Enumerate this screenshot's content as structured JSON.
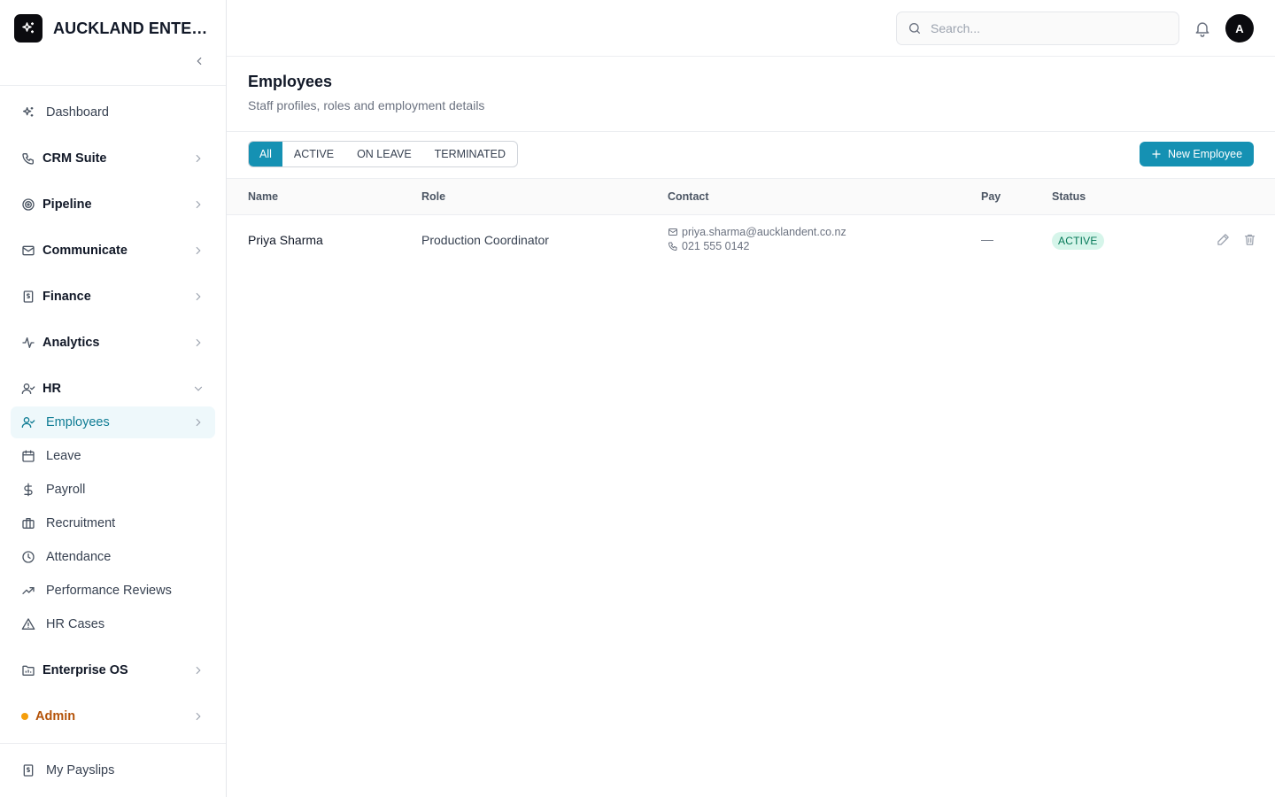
{
  "brand": {
    "name": "AUCKLAND ENTERPRISES",
    "logo_icon": "sparkles-icon"
  },
  "sidebar": {
    "items": [
      {
        "label": "Dashboard",
        "icon": "sparkles-icon"
      },
      {
        "label": "CRM Suite",
        "icon": "phone-icon"
      },
      {
        "label": "Pipeline",
        "icon": "target-icon"
      },
      {
        "label": "Communicate",
        "icon": "mail-icon"
      },
      {
        "label": "Finance",
        "icon": "receipt-icon"
      },
      {
        "label": "Analytics",
        "icon": "activity-icon"
      },
      {
        "label": "HR",
        "icon": "user-check-icon"
      },
      {
        "label": "Employees",
        "icon": "user-check-icon"
      },
      {
        "label": "Leave",
        "icon": "calendar-icon"
      },
      {
        "label": "Payroll",
        "icon": "dollar-icon"
      },
      {
        "label": "Recruitment",
        "icon": "briefcase-icon"
      },
      {
        "label": "Attendance",
        "icon": "clock-icon"
      },
      {
        "label": "Performance Reviews",
        "icon": "trending-up-icon"
      },
      {
        "label": "HR Cases",
        "icon": "alert-triangle-icon"
      },
      {
        "label": "Enterprise OS",
        "icon": "folder-icon"
      },
      {
        "label": "Admin",
        "icon": "dot-icon"
      },
      {
        "label": "My Payslips",
        "icon": "receipt-icon"
      }
    ]
  },
  "search": {
    "placeholder": "Search..."
  },
  "user": {
    "initial": "A"
  },
  "page": {
    "title": "Employees",
    "subtitle": "Staff profiles, roles and employment details"
  },
  "filters": {
    "tabs": [
      "All",
      "ACTIVE",
      "ON LEAVE",
      "TERMINATED"
    ],
    "selected": "All"
  },
  "actions": {
    "new_label": "New Employee"
  },
  "table": {
    "columns": [
      "Name",
      "Role",
      "Contact",
      "Pay",
      "Status"
    ],
    "rows": [
      {
        "name": "Priya Sharma",
        "role": "Production Coordinator",
        "email": "priya.sharma@aucklandent.co.nz",
        "phone": "021 555 0142",
        "pay": "—",
        "status": "ACTIVE"
      }
    ]
  },
  "colors": {
    "accent": "#1591b3",
    "active_nav_bg": "#eef8fb",
    "active_nav_text": "#0f7c94",
    "status_active_bg": "#d6f5ea",
    "status_active_text": "#047857",
    "admin": "#b45309",
    "admin_dot": "#f59e0b"
  }
}
